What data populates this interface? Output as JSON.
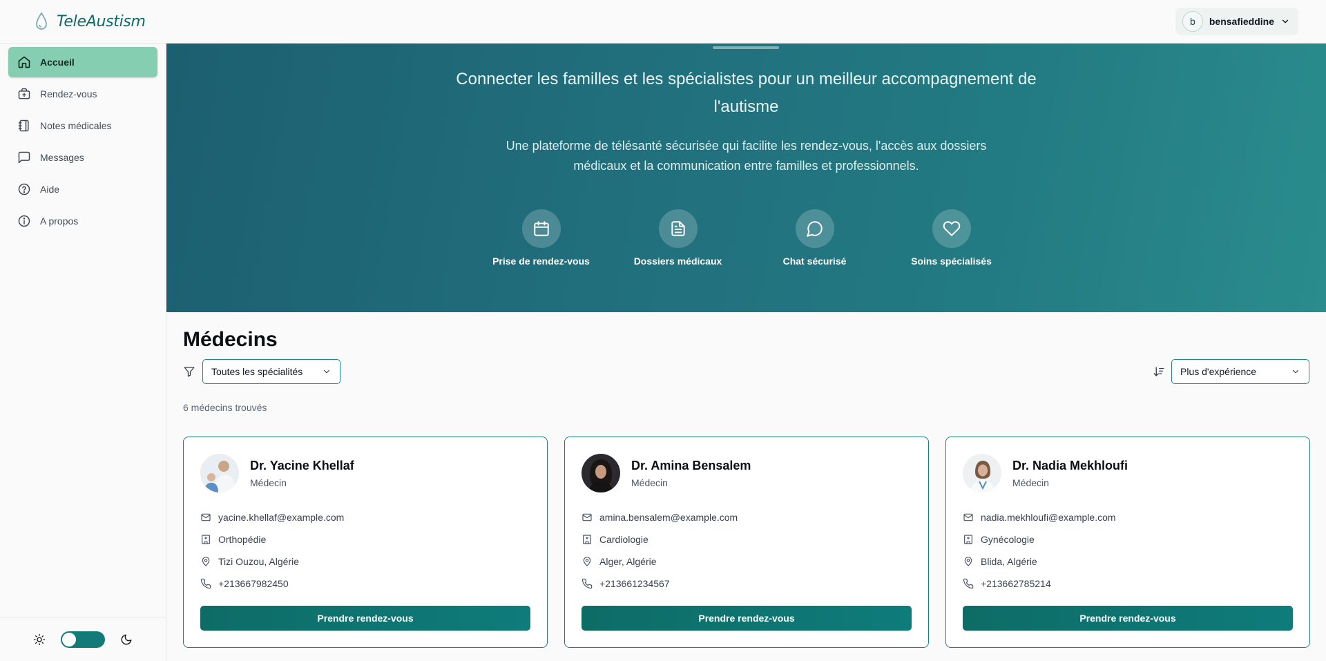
{
  "app": {
    "name": "TeleAustism"
  },
  "user": {
    "initial": "b",
    "name": "bensafieddine"
  },
  "sidebar": {
    "items": [
      {
        "label": "Accueil",
        "icon": "home-icon",
        "active": true
      },
      {
        "label": "Rendez-vous",
        "icon": "medical-bag-icon"
      },
      {
        "label": "Notes médicales",
        "icon": "notebook-icon"
      },
      {
        "label": "Messages",
        "icon": "message-icon"
      },
      {
        "label": "Aide",
        "icon": "help-circle-icon"
      },
      {
        "label": "A propos",
        "icon": "info-icon"
      }
    ]
  },
  "hero": {
    "title": "Connecter les familles et les spécialistes pour un meilleur accompagnement de l'autisme",
    "subtitle": "Une plateforme de télésanté sécurisée qui facilite les rendez-vous, l'accès aux dossiers médicaux et la communication entre familles et professionnels.",
    "features": [
      {
        "label": "Prise de rendez-vous",
        "icon": "calendar-icon"
      },
      {
        "label": "Dossiers médicaux",
        "icon": "document-icon"
      },
      {
        "label": "Chat sécurisé",
        "icon": "chat-icon"
      },
      {
        "label": "Soins spécialisés",
        "icon": "heart-icon"
      }
    ]
  },
  "doctors": {
    "title": "Médecins",
    "specialty_filter": "Toutes les spécialités",
    "sort": "Plus d'expérience",
    "count_text": "6 médecins trouvés",
    "book_label": "Prendre rendez-vous",
    "cards": [
      {
        "name": "Dr. Yacine Khellaf",
        "role": "Médecin",
        "email": "yacine.khellaf@example.com",
        "specialty": "Orthopédie",
        "location": "Tizi Ouzou, Algérie",
        "phone": "+213667982450"
      },
      {
        "name": "Dr. Amina Bensalem",
        "role": "Médecin",
        "email": "amina.bensalem@example.com",
        "specialty": "Cardiologie",
        "location": "Alger, Algérie",
        "phone": "+213661234567"
      },
      {
        "name": "Dr. Nadia Mekhloufi",
        "role": "Médecin",
        "email": "nadia.mekhloufi@example.com",
        "specialty": "Gynécologie",
        "location": "Blida, Algérie",
        "phone": "+213662785214"
      }
    ]
  },
  "colors": {
    "primary": "#0e6c66",
    "accent_active": "#86ceb1",
    "hero_start": "#1c5f70",
    "hero_end": "#2a8c8d"
  }
}
